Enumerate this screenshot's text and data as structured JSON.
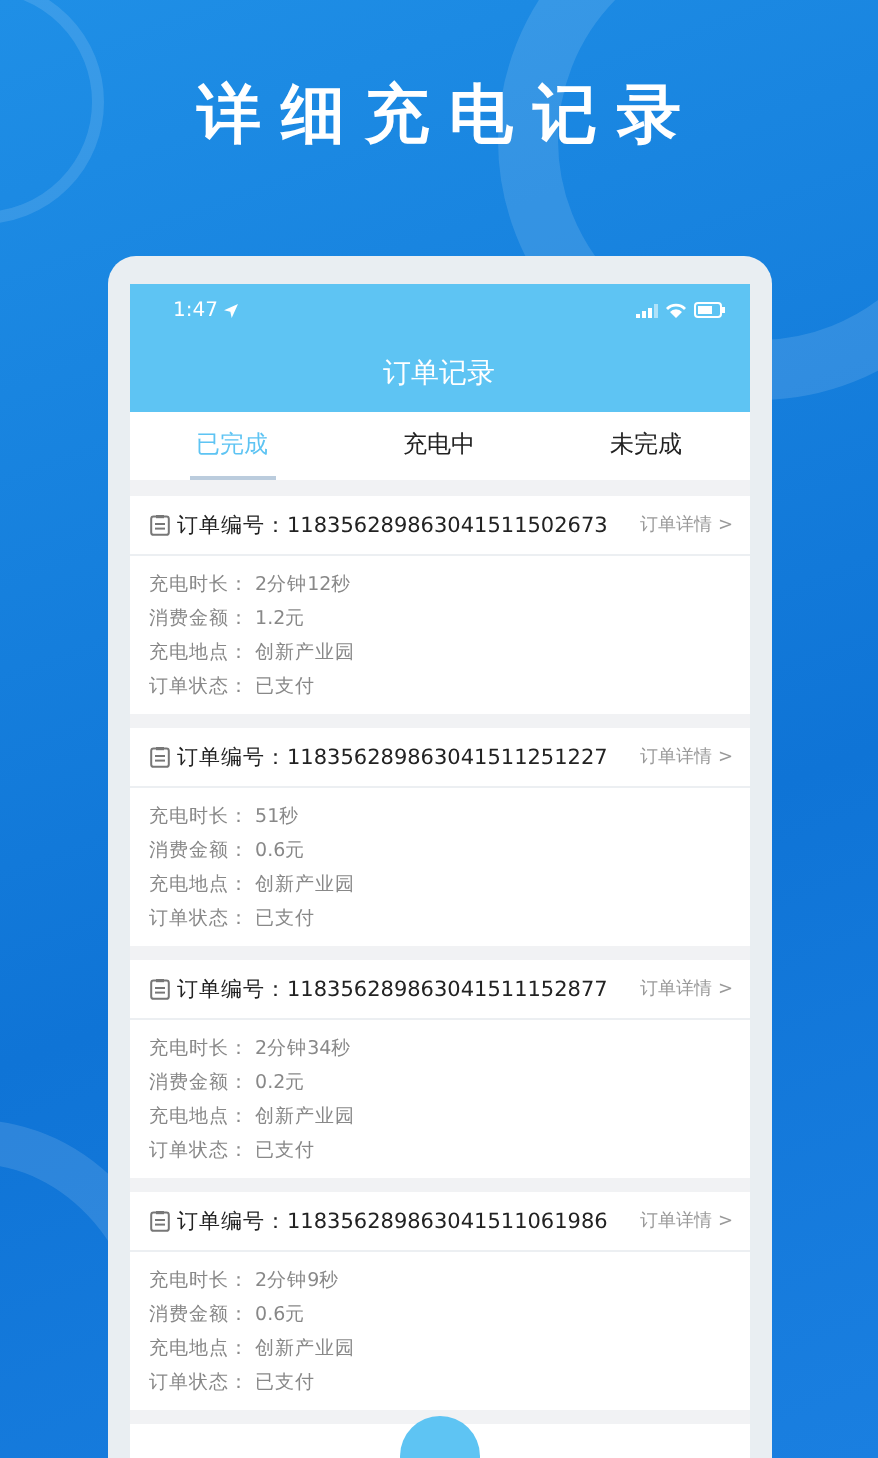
{
  "headline": "详细充电记录",
  "status_bar": {
    "time": "1:47"
  },
  "nav": {
    "title": "订单记录"
  },
  "tabs": [
    {
      "label": "已完成",
      "selected": true
    },
    {
      "label": "充电中",
      "selected": false
    },
    {
      "label": "未完成",
      "selected": false
    }
  ],
  "orders": [
    {
      "number_label": "订单编号：",
      "number": "118356289863041511502673",
      "detail_link": "订单详情 >",
      "fields": [
        {
          "label": "充电时长：",
          "value": "2分钟12秒"
        },
        {
          "label": "消费金额：",
          "value": "1.2元"
        },
        {
          "label": "充电地点：",
          "value": "创新产业园"
        },
        {
          "label": "订单状态：",
          "value": "已支付"
        }
      ]
    },
    {
      "number_label": "订单编号：",
      "number": "118356289863041511251227",
      "detail_link": "订单详情 >",
      "fields": [
        {
          "label": "充电时长：",
          "value": "51秒"
        },
        {
          "label": "消费金额：",
          "value": "0.6元"
        },
        {
          "label": "充电地点：",
          "value": "创新产业园"
        },
        {
          "label": "订单状态：",
          "value": "已支付"
        }
      ]
    },
    {
      "number_label": "订单编号：",
      "number": "118356289863041511152877",
      "detail_link": "订单详情 >",
      "fields": [
        {
          "label": "充电时长：",
          "value": "2分钟34秒"
        },
        {
          "label": "消费金额：",
          "value": "0.2元"
        },
        {
          "label": "充电地点：",
          "value": "创新产业园"
        },
        {
          "label": "订单状态：",
          "value": "已支付"
        }
      ]
    },
    {
      "number_label": "订单编号：",
      "number": "118356289863041511061986",
      "detail_link": "订单详情 >",
      "fields": [
        {
          "label": "充电时长：",
          "value": "2分钟9秒"
        },
        {
          "label": "消费金额：",
          "value": "0.6元"
        },
        {
          "label": "充电地点：",
          "value": "创新产业园"
        },
        {
          "label": "订单状态：",
          "value": "已支付"
        }
      ]
    }
  ]
}
